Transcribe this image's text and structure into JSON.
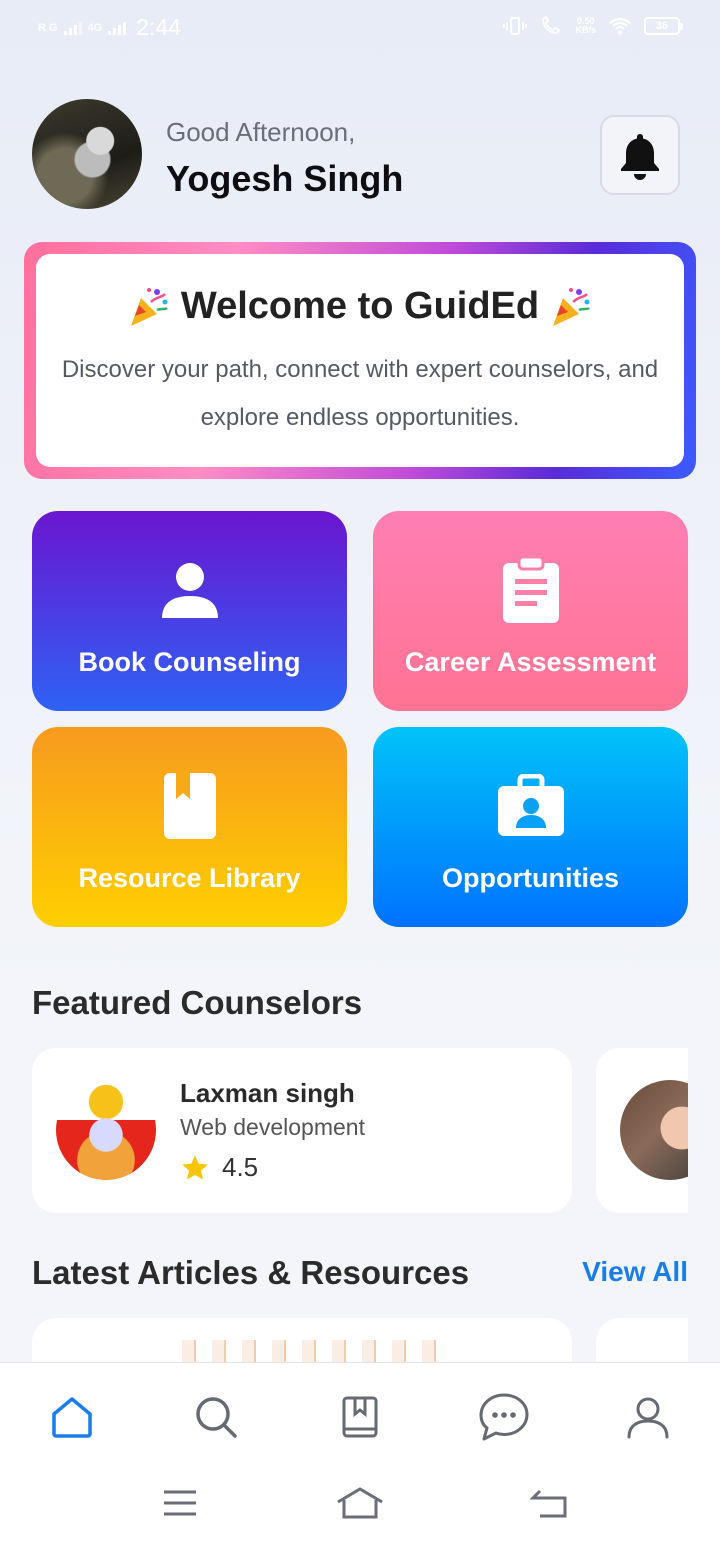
{
  "status_bar": {
    "network_left": "R G",
    "network_right": "4G",
    "time": "2:44",
    "speed_value": "0.50",
    "speed_unit": "KB/s",
    "battery": "36"
  },
  "header": {
    "greeting": "Good Afternoon,",
    "user_name": "Yogesh Singh",
    "avatar_icon": "user-avatar",
    "notification_icon": "bell-icon"
  },
  "welcome": {
    "emoji_left": "party-popper-icon",
    "title": "Welcome to GuidEd",
    "emoji_right": "party-popper-icon",
    "subtitle": "Discover your path, connect with expert counselors, and explore endless opportunities."
  },
  "features": [
    {
      "label": "Book Counseling",
      "icon": "person-icon"
    },
    {
      "label": "Career Assessment",
      "icon": "clipboard-icon"
    },
    {
      "label": "Resource Library",
      "icon": "bookmark-book-icon"
    },
    {
      "label": "Opportunities",
      "icon": "briefcase-icon"
    }
  ],
  "featured_counselors": {
    "title": "Featured Counselors",
    "items": [
      {
        "name": "Laxman singh",
        "specialty": "Web development",
        "rating": "4.5"
      }
    ]
  },
  "articles": {
    "title": "Latest Articles & Resources",
    "view_all": "View All"
  },
  "bottom_nav": {
    "items": [
      "home-icon",
      "search-icon",
      "library-icon",
      "chat-icon",
      "profile-icon"
    ],
    "active": "home-icon",
    "active_color": "#1a7de8",
    "inactive_color": "#666a72"
  },
  "system_nav": [
    "menu-icon",
    "home-icon",
    "back-icon"
  ]
}
